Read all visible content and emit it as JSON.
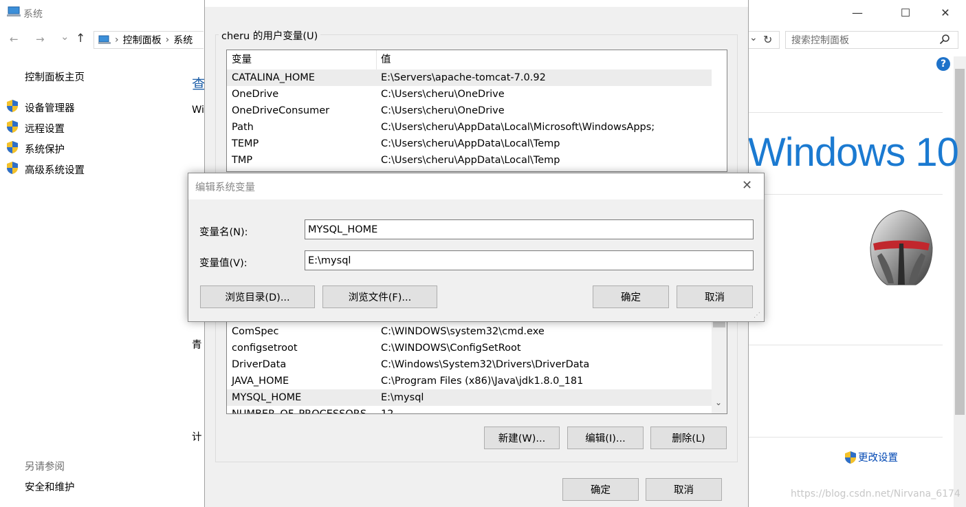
{
  "window": {
    "title": "系统",
    "controls": {
      "minimize": "—",
      "maximize": "☐",
      "close": "✕"
    }
  },
  "navbar": {
    "back": "←",
    "forward": "→",
    "recent": "⌄",
    "up": "↑",
    "breadcrumb": [
      "控制面板",
      "系统"
    ],
    "separator": "›",
    "search_placeholder": "搜索控制面板",
    "refresh": "↻",
    "dropdown": "⌄"
  },
  "help": {
    "label": "?"
  },
  "sidebar": {
    "home": "控制面板主页",
    "items": [
      {
        "label": "设备管理器",
        "icon": "shield-icon"
      },
      {
        "label": "远程设置",
        "icon": "shield-icon"
      },
      {
        "label": "系统保护",
        "icon": "shield-icon"
      },
      {
        "label": "高级系统设置",
        "icon": "shield-icon"
      }
    ],
    "see_also_heading": "另请参阅",
    "see_also": [
      "安全和维护"
    ]
  },
  "main_partial": {
    "heading": "查",
    "line1": "Wi",
    "line2": "青",
    "line3": "计"
  },
  "right_panel": {
    "logo_text": "Windows 10",
    "change_settings": "更改设置"
  },
  "watermark": "https://blog.csdn.net/Nirvana_6174",
  "env_dialog": {
    "user_group_label": "cheru 的用户变量(U)",
    "columns": [
      "变量",
      "值"
    ],
    "user_vars": [
      {
        "name": "CATALINA_HOME",
        "value": "E:\\Servers\\apache-tomcat-7.0.92",
        "selected": true
      },
      {
        "name": "OneDrive",
        "value": "C:\\Users\\cheru\\OneDrive"
      },
      {
        "name": "OneDriveConsumer",
        "value": "C:\\Users\\cheru\\OneDrive"
      },
      {
        "name": "Path",
        "value": "C:\\Users\\cheru\\AppData\\Local\\Microsoft\\WindowsApps;"
      },
      {
        "name": "TEMP",
        "value": "C:\\Users\\cheru\\AppData\\Local\\Temp"
      },
      {
        "name": "TMP",
        "value": "C:\\Users\\cheru\\AppData\\Local\\Temp"
      }
    ],
    "sys_vars": [
      {
        "name": "ComSpec",
        "value": "C:\\WINDOWS\\system32\\cmd.exe"
      },
      {
        "name": "configsetroot",
        "value": "C:\\WINDOWS\\ConfigSetRoot"
      },
      {
        "name": "DriverData",
        "value": "C:\\Windows\\System32\\Drivers\\DriverData"
      },
      {
        "name": "JAVA_HOME",
        "value": "C:\\Program Files (x86)\\Java\\jdk1.8.0_181"
      },
      {
        "name": "MYSQL_HOME",
        "value": "E:\\mysql",
        "selected": true
      },
      {
        "name": "NUMBER_OF_PROCESSORS",
        "value": "12"
      }
    ],
    "buttons": {
      "new": "新建(W)...",
      "edit": "编辑(I)...",
      "delete": "删除(L)",
      "ok": "确定",
      "cancel": "取消"
    }
  },
  "edit_dialog": {
    "title": "编辑系统变量",
    "close": "✕",
    "name_label": "变量名(N):",
    "name_value": "MYSQL_HOME",
    "value_label": "变量值(V):",
    "value_value": "E:\\mysql",
    "buttons": {
      "browse_dir": "浏览目录(D)...",
      "browse_file": "浏览文件(F)...",
      "ok": "确定",
      "cancel": "取消"
    }
  }
}
